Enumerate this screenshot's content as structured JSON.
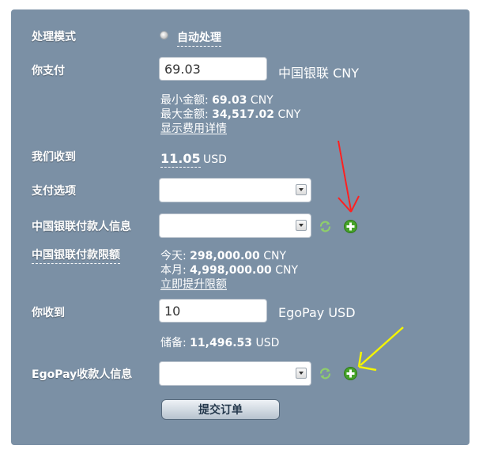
{
  "mode": {
    "label": "处理模式",
    "option": "自动处理"
  },
  "you_pay": {
    "label": "你支付",
    "value": "69.03",
    "currency": "中国银联 CNY",
    "min_label": "最小金额:",
    "min_value": "69.03",
    "min_cur": "CNY",
    "max_label": "最大金额:",
    "max_value": "34,517.02",
    "max_cur": "CNY",
    "fee_link": "显示费用详情"
  },
  "we_receive": {
    "label": "我们收到",
    "amount": "11.05",
    "currency": "USD"
  },
  "payment_option": {
    "label": "支付选项"
  },
  "payer_info": {
    "label": "中国银联付款人信息"
  },
  "limits": {
    "label": "中国银联付款限额",
    "today_label": "今天:",
    "today_value": "298,000.00",
    "today_cur": "CNY",
    "month_label": "本月:",
    "month_value": "4,998,000.00",
    "month_cur": "CNY",
    "raise_link": "立即提升限额"
  },
  "you_receive": {
    "label": "你收到",
    "value": "10",
    "currency": "EgoPay USD",
    "reserve_label": "储备:",
    "reserve_value": "11,496.53",
    "reserve_cur": "USD"
  },
  "payee_info": {
    "label": "EgoPay收款人信息"
  },
  "submit": {
    "label": "提交订单"
  },
  "colors": {
    "panel": "#7b90a5",
    "annotation_red": "#ff2020",
    "annotation_yellow": "#f4f400",
    "add_green": "#46a32a"
  },
  "icons": [
    "radio-icon",
    "refresh-icon",
    "add-icon",
    "red-arrow-icon",
    "yellow-arrow-icon"
  ]
}
